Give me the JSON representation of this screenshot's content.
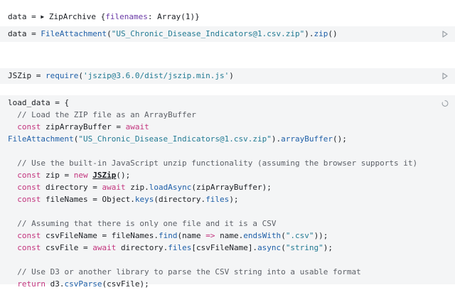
{
  "output_line": {
    "lhs": "data",
    "eq": " = ",
    "object": "ZipArchive",
    "brace_open": " {",
    "key": "filenames",
    "colon": ": ",
    "value": "Array(1)",
    "brace_close": "}"
  },
  "cell1": {
    "t1": "data",
    "t2": " = ",
    "t3": "FileAttachment",
    "t4": "(",
    "t5": "\"US_Chronic_Disease_Indicators@1.csv.zip\"",
    "t6": ").",
    "t7": "zip",
    "t8": "()"
  },
  "cell2": {
    "t1": "JSZip",
    "t2": " = ",
    "t3": "require",
    "t4": "(",
    "t5": "'jszip@3.6.0/dist/jszip.min.js'",
    "t6": ")"
  },
  "cell3": {
    "l1_a": "load_data",
    "l1_b": " = {",
    "l2": "  // Load the ZIP file as an ArrayBuffer",
    "l3_a": "  ",
    "l3_b": "const",
    "l3_c": " zipArrayBuffer = ",
    "l3_d": "await",
    "l4_a": "FileAttachment",
    "l4_b": "(",
    "l4_c": "\"US_Chronic_Disease_Indicators@1.csv.zip\"",
    "l4_d": ").",
    "l4_e": "arrayBuffer",
    "l4_f": "();",
    "l6": "  // Use the built-in JavaScript unzip functionality (assuming the browser supports it)",
    "l7_a": "  ",
    "l7_b": "const",
    "l7_c": " zip = ",
    "l7_d": "new",
    "l7_e": " ",
    "l7_f": "JSZip",
    "l7_g": "();",
    "l8_a": "  ",
    "l8_b": "const",
    "l8_c": " directory = ",
    "l8_d": "await",
    "l8_e": " zip.",
    "l8_f": "loadAsync",
    "l8_g": "(zipArrayBuffer);",
    "l9_a": "  ",
    "l9_b": "const",
    "l9_c": " fileNames = Object.",
    "l9_d": "keys",
    "l9_e": "(directory.",
    "l9_f": "files",
    "l9_g": ");",
    "l11": "  // Assuming that there is only one file and it is a CSV",
    "l12_a": "  ",
    "l12_b": "const",
    "l12_c": " csvFileName = fileNames.",
    "l12_d": "find",
    "l12_e": "(name ",
    "l12_f": "=>",
    "l12_g": " name.",
    "l12_h": "endsWith",
    "l12_i": "(",
    "l12_j": "\".csv\"",
    "l12_k": "));",
    "l13_a": "  ",
    "l13_b": "const",
    "l13_c": " csvFile = ",
    "l13_d": "await",
    "l13_e": " directory.",
    "l13_f": "files",
    "l13_g": "[csvFileName].",
    "l13_h": "async",
    "l13_i": "(",
    "l13_j": "\"string\"",
    "l13_k": ");",
    "l15": "  // Use D3 or another library to parse the CSV string into a usable format",
    "l16_a": "  ",
    "l16_b": "return",
    "l16_c": " d3.",
    "l16_d": "csvParse",
    "l16_e": "(csvFile);"
  },
  "icons": {
    "run": "play-icon",
    "pending": "spinner-icon",
    "expand": "triangle-right-icon"
  },
  "colors": {
    "cell_bg": "#f4f5f6",
    "keyword": "#c3357e",
    "string": "#227a93",
    "function": "#1e5fa8",
    "comment": "#5b5f66"
  }
}
